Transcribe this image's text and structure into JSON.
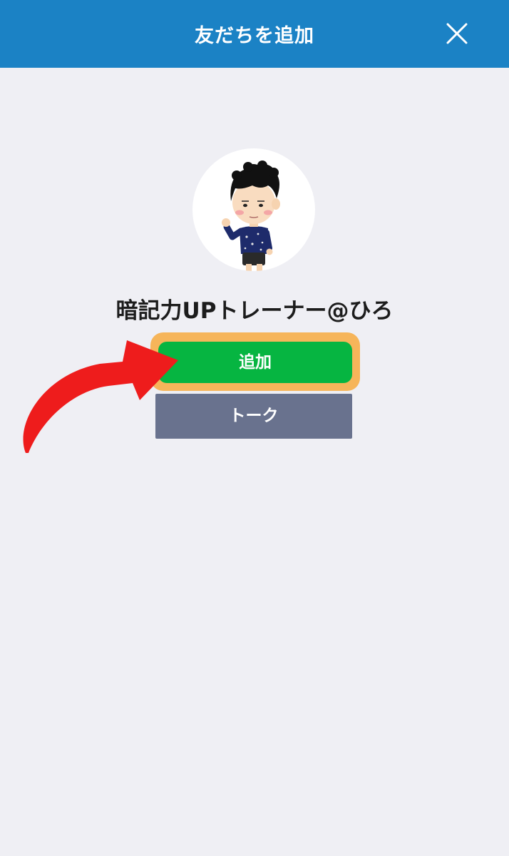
{
  "header": {
    "title": "友だちを追加",
    "close_icon": "close-icon",
    "background_color": "#1b82c5"
  },
  "profile": {
    "avatar_icon": "avatar-illustration",
    "name": "暗記力UPトレーナー@ひろ"
  },
  "actions": {
    "add_label": "追加",
    "add_color": "#06b541",
    "add_highlight_color": "#f6b55a",
    "talk_label": "トーク",
    "talk_color": "#69728e"
  },
  "annotation": {
    "arrow_icon": "red-arrow-icon",
    "arrow_color": "#ee1c1c"
  }
}
